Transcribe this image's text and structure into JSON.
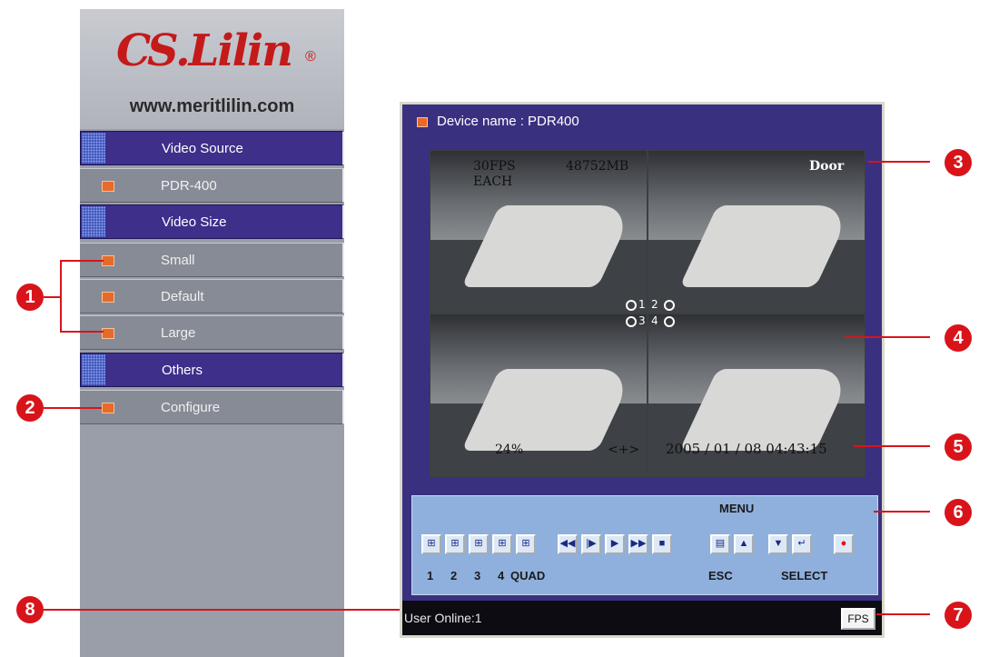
{
  "sidebar": {
    "logo": {
      "brand": "S.Lilin",
      "initial": "C",
      "reg": "®",
      "url": "www.meritlilin.com"
    },
    "items": [
      {
        "label": "Video Source",
        "type": "header"
      },
      {
        "label": "PDR-400",
        "type": "item"
      },
      {
        "label": "Video Size",
        "type": "header"
      },
      {
        "label": "Small",
        "type": "item"
      },
      {
        "label": "Default",
        "type": "item"
      },
      {
        "label": "Large",
        "type": "item"
      },
      {
        "label": "Others",
        "type": "header"
      },
      {
        "label": "Configure",
        "type": "item"
      }
    ]
  },
  "viewer": {
    "device_name": "Device name : PDR400",
    "overlay": {
      "fps": "30FPS",
      "each": "EACH",
      "storage": "48752MB",
      "camera": "Door",
      "percent": "24%",
      "arrows": "<+>",
      "timestamp": "2005 / 01 / 08  04:43:15",
      "quad_numbers": [
        "1",
        "2",
        "3",
        "4"
      ]
    },
    "controls": {
      "menu": "MENU",
      "labels": {
        "one": "1",
        "two": "2",
        "three": "3",
        "four": "4",
        "quad": "QUAD",
        "esc": "ESC",
        "select": "SELECT"
      },
      "buttons": [
        {
          "name": "camera-1-button",
          "glyph": "⊞"
        },
        {
          "name": "camera-2-button",
          "glyph": "⊞"
        },
        {
          "name": "camera-3-button",
          "glyph": "⊞"
        },
        {
          "name": "camera-4-button",
          "glyph": "⊞"
        },
        {
          "name": "quad-button",
          "glyph": "⊞"
        },
        {
          "name": "rewind-button",
          "glyph": "◀◀"
        },
        {
          "name": "step-button",
          "glyph": "|▶"
        },
        {
          "name": "play-button",
          "glyph": "▶"
        },
        {
          "name": "fast-forward-button",
          "glyph": "▶▶"
        },
        {
          "name": "stop-button",
          "glyph": "■"
        },
        {
          "name": "esc-button",
          "glyph": "▤"
        },
        {
          "name": "up-button",
          "glyph": "▲"
        },
        {
          "name": "down-button",
          "glyph": "▼"
        },
        {
          "name": "select-button",
          "glyph": "↵"
        },
        {
          "name": "record-button",
          "glyph": "●"
        }
      ]
    },
    "status": {
      "user_online": "User Online:1",
      "fps_button": "FPS"
    }
  },
  "callouts": [
    "1",
    "2",
    "3",
    "4",
    "5",
    "6",
    "7",
    "8"
  ],
  "colors": {
    "accent": "#d8141a",
    "sidebar_header": "#3d2f8a",
    "viewer_bg": "#3a3080",
    "controls_bg": "#8fb0dc",
    "bullet": "#e86a2a"
  }
}
